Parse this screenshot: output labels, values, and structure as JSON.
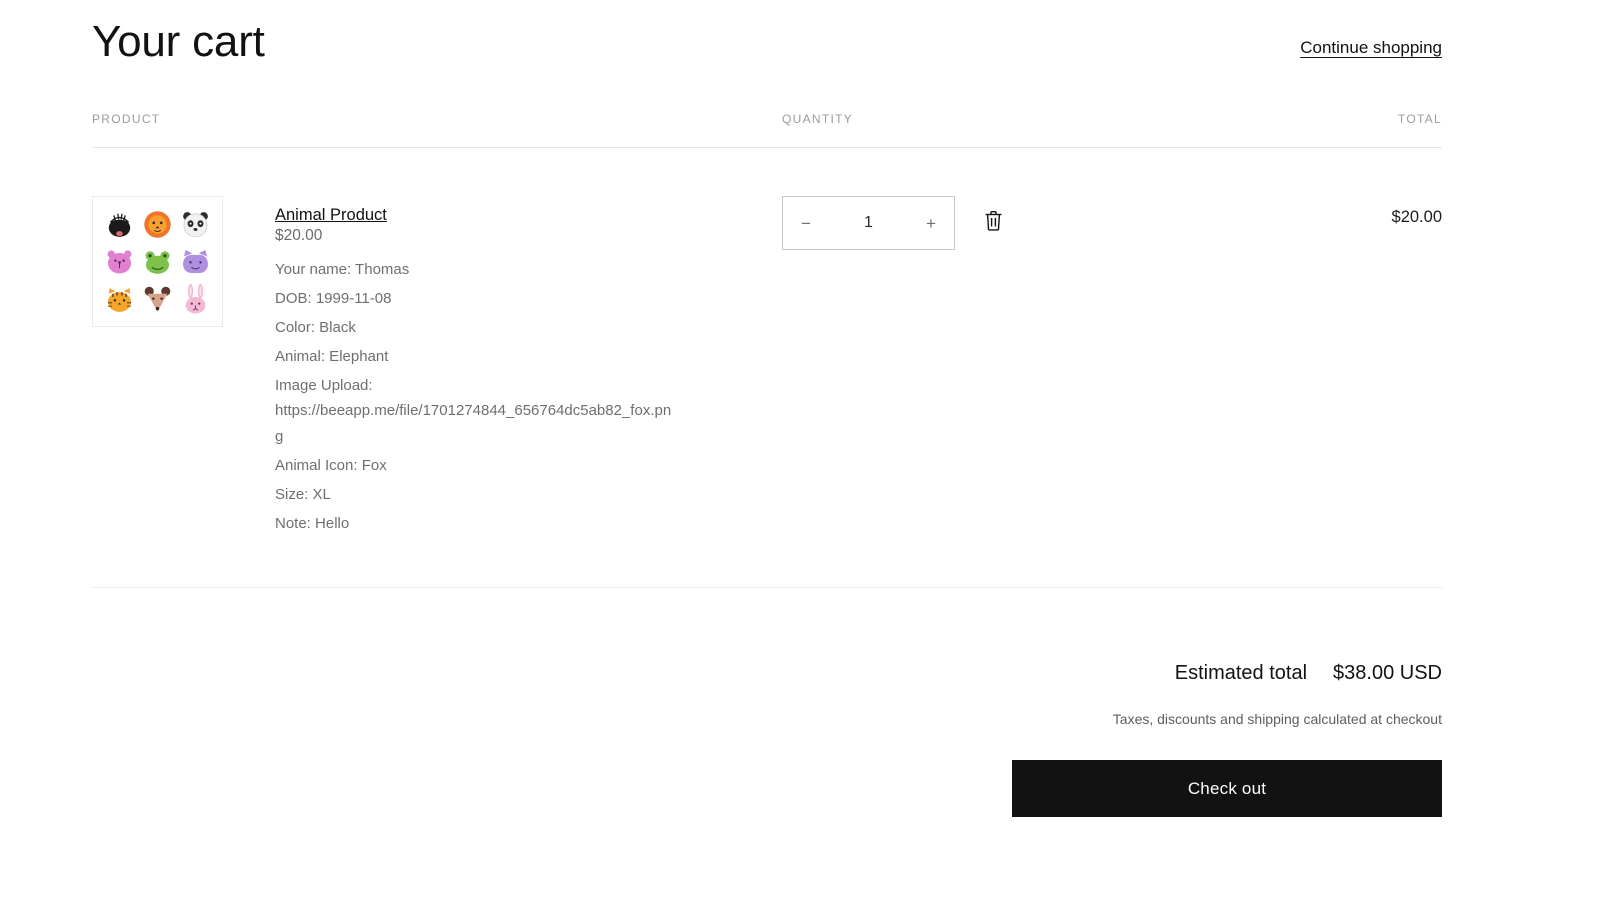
{
  "page": {
    "title": "Your cart",
    "continue_shopping_label": "Continue shopping"
  },
  "table": {
    "headers": {
      "product": "PRODUCT",
      "quantity": "QUANTITY",
      "total": "TOTAL"
    }
  },
  "item": {
    "name": "Animal Product",
    "unit_price": "$20.00",
    "line_total": "$20.00",
    "thumbnail_alt": "animal-faces-grid",
    "properties": [
      {
        "label": "Your name",
        "text": "Your name: Thomas"
      },
      {
        "label": "DOB",
        "text": "DOB: 1999-11-08"
      },
      {
        "label": "Color",
        "text": "Color: Black"
      },
      {
        "label": "Animal",
        "text": "Animal: Elephant"
      },
      {
        "label": "Image Upload",
        "text": "Image Upload: https://beeapp.me/file/1701274844_656764dc5ab82_fox.png"
      },
      {
        "label": "Animal Icon",
        "text": "Animal Icon: Fox"
      },
      {
        "label": "Size",
        "text": "Size: XL"
      },
      {
        "label": "Note",
        "text": "Note: Hello"
      }
    ],
    "quantity": {
      "value": "1",
      "decrease_label": "−",
      "increase_label": "+",
      "remove_label": "remove-item"
    }
  },
  "summary": {
    "estimated_total_label": "Estimated total",
    "estimated_total_value": "$38.00 USD",
    "tax_note": "Taxes, discounts and shipping calculated at checkout",
    "checkout_label": "Check out"
  },
  "colors": {
    "text_primary": "#121212",
    "text_muted": "#6f6f6f",
    "header_muted": "#9b9b9b",
    "rule": "#e6e6e6",
    "button_bg": "#121212",
    "button_fg": "#ffffff"
  }
}
